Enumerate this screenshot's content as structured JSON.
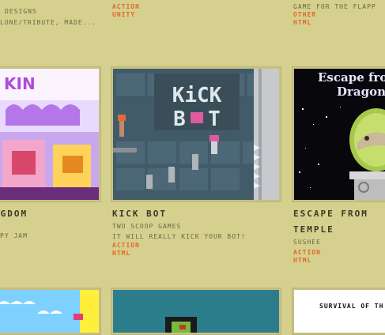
{
  "top_row": {
    "col1": {
      "line1": "DESIGNS",
      "line2": "LONE/TRIBUTE, MADE..."
    },
    "col2": {
      "tags": [
        "ACTION",
        "UNITY"
      ]
    },
    "col3": {
      "desc": "GAME FOR THE FLAPP",
      "tags": [
        "OTHER",
        "HTML"
      ]
    }
  },
  "games": [
    {
      "title": "NGDOM",
      "author": "PY JAM",
      "thumb_text": "KIN"
    },
    {
      "title": "KICK BOT",
      "author": "TWO SCOOP GAMES",
      "description": "IT WILL REALLY KICK YOUR BOT!",
      "tags": [
        "ACTION",
        "HTML"
      ],
      "thumb_text": {
        "line1": "KiCK",
        "line2a": "B",
        "line2b": "T"
      }
    },
    {
      "title": "ESCAPE FROM",
      "title2": "TEMPLE",
      "author": "SUSHEE",
      "tags": [
        "ACTION",
        "HTML"
      ],
      "thumb_text": {
        "line1": "Escape fro",
        "line2": "Dragon"
      }
    }
  ],
  "bottom_row": {
    "col3_banner": "SURVIVAL OF TH"
  },
  "colors": {
    "background": "#d6d08e",
    "tag": "#e0682a",
    "title": "#3b3926",
    "meta": "#6b6745"
  }
}
